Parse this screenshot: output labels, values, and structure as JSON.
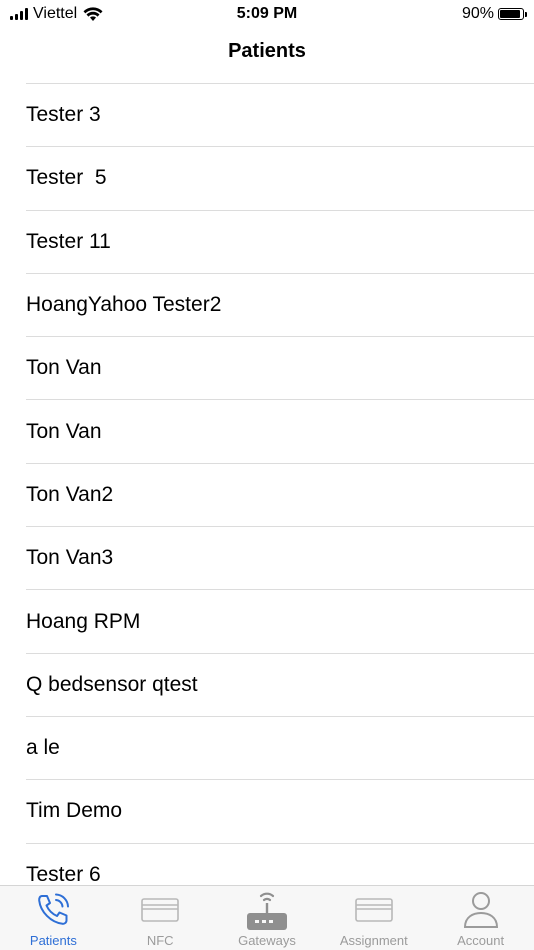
{
  "status": {
    "carrier": "Viettel",
    "time": "5:09 PM",
    "battery": "90%",
    "battery_level": 0.9
  },
  "nav": {
    "title": "Patients"
  },
  "patients": [
    "Tester 3",
    "Tester  5",
    "Tester 11",
    "HoangYahoo Tester2",
    "Ton Van",
    "Ton Van",
    "Ton Van2",
    "Ton Van3",
    "Hoang RPM",
    "Q bedsensor qtest",
    "a le",
    "Tim Demo",
    "Tester 6"
  ],
  "tabs": [
    {
      "label": "Patients",
      "icon": "phone-icon",
      "active": true
    },
    {
      "label": "NFC",
      "icon": "card-icon",
      "active": false
    },
    {
      "label": "Gateways",
      "icon": "router-icon",
      "active": false
    },
    {
      "label": "Assignment",
      "icon": "card-icon",
      "active": false
    },
    {
      "label": "Account",
      "icon": "person-icon",
      "active": false
    }
  ],
  "colors": {
    "accent": "#2e6fd6",
    "inactive": "#9b9b9b"
  }
}
